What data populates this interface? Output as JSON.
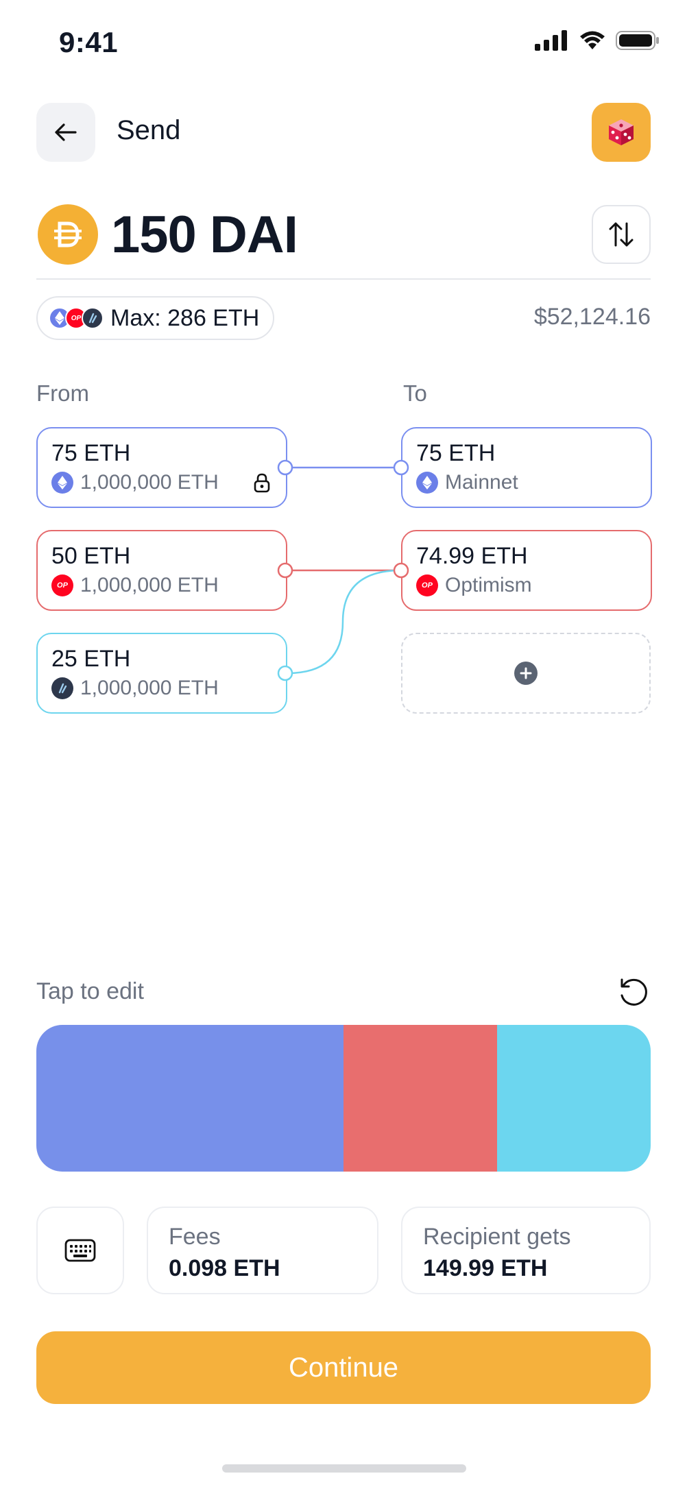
{
  "status_bar": {
    "time": "9:41"
  },
  "header": {
    "title": "Send"
  },
  "amount": {
    "text": "150 DAI",
    "token_icon": "dai-icon"
  },
  "max_chip": {
    "label": "Max: 286 ETH",
    "usd_value": "$52,124.16"
  },
  "from": {
    "label": "From",
    "items": [
      {
        "amount": "75 ETH",
        "balance": "1,000,000 ETH",
        "network_icon": "ethereum-icon",
        "color": "#7a8ff0",
        "locked": true
      },
      {
        "amount": "50 ETH",
        "balance": "1,000,000 ETH",
        "network_icon": "optimism-icon",
        "color": "#e56b6d",
        "locked": false
      },
      {
        "amount": "25 ETH",
        "balance": "1,000,000 ETH",
        "network_icon": "arbitrum-icon",
        "color": "#6dd5ee",
        "locked": false
      }
    ]
  },
  "to": {
    "label": "To",
    "items": [
      {
        "amount": "75 ETH",
        "network": "Mainnet",
        "network_icon": "ethereum-icon",
        "color": "#7a8ff0"
      },
      {
        "amount": "74.99 ETH",
        "network": "Optimism",
        "network_icon": "optimism-icon",
        "color": "#e56b6d"
      }
    ]
  },
  "edit": {
    "label": "Tap to edit",
    "distribution": [
      {
        "share": 0.5,
        "color": "#7790ea"
      },
      {
        "share": 0.25,
        "color": "#e86e6e"
      },
      {
        "share": 0.25,
        "color": "#6cd6ef"
      }
    ]
  },
  "fees": {
    "label": "Fees",
    "value": "0.098 ETH"
  },
  "recipient": {
    "label": "Recipient gets",
    "value": "149.99 ETH"
  },
  "continue_label": "Continue",
  "colors": {
    "accent": "#f5b13d",
    "eth": "#6b7fe8",
    "op": "#ff0420",
    "arb": "#2d374b"
  }
}
